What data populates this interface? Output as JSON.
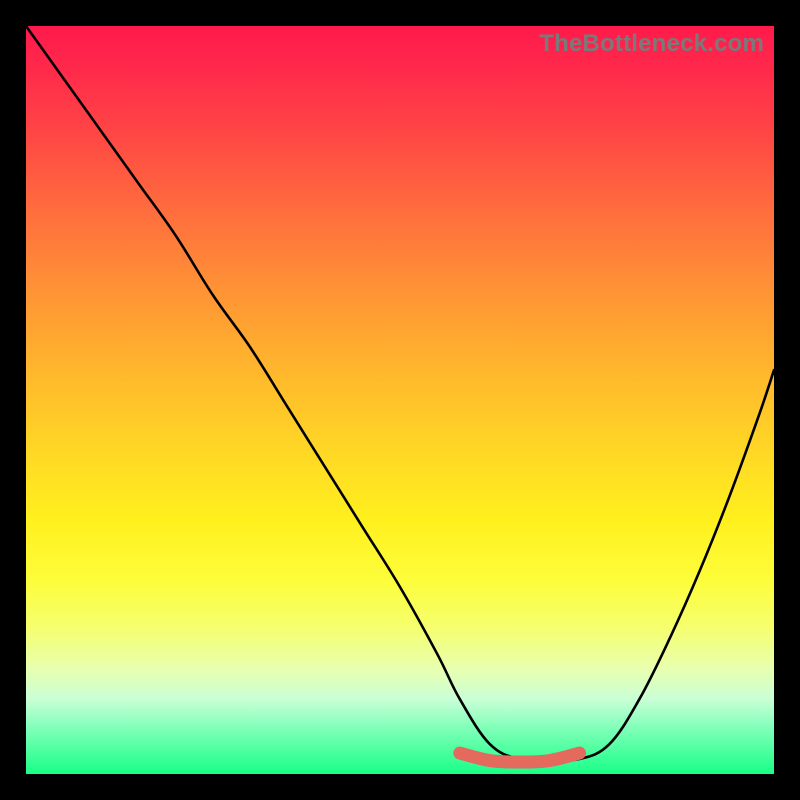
{
  "watermark": "TheBottleneck.com",
  "chart_data": {
    "type": "line",
    "title": "",
    "xlabel": "",
    "ylabel": "",
    "xlim": [
      0,
      100
    ],
    "ylim": [
      0,
      100
    ],
    "grid": false,
    "legend": false,
    "series": [
      {
        "name": "bottleneck-curve",
        "color": "#000000",
        "x": [
          0,
          5,
          10,
          15,
          20,
          25,
          30,
          35,
          40,
          45,
          50,
          55,
          58,
          62,
          66,
          70,
          74,
          78,
          82,
          86,
          90,
          94,
          98,
          100
        ],
        "y": [
          100,
          93,
          86,
          79,
          72,
          64,
          57,
          49,
          41,
          33,
          25,
          16,
          10,
          4,
          2,
          2,
          2,
          4,
          10,
          18,
          27,
          37,
          48,
          54
        ]
      },
      {
        "name": "optimal-band",
        "color": "#e46a5e",
        "x": [
          58,
          62,
          66,
          70,
          74
        ],
        "y": [
          2.8,
          1.8,
          1.6,
          1.8,
          2.8
        ]
      }
    ],
    "gradient_stops": [
      {
        "pos": 0,
        "color": "#ff1a4b"
      },
      {
        "pos": 50,
        "color": "#ffd226"
      },
      {
        "pos": 75,
        "color": "#fdfd3a"
      },
      {
        "pos": 100,
        "color": "#18ff86"
      }
    ]
  }
}
